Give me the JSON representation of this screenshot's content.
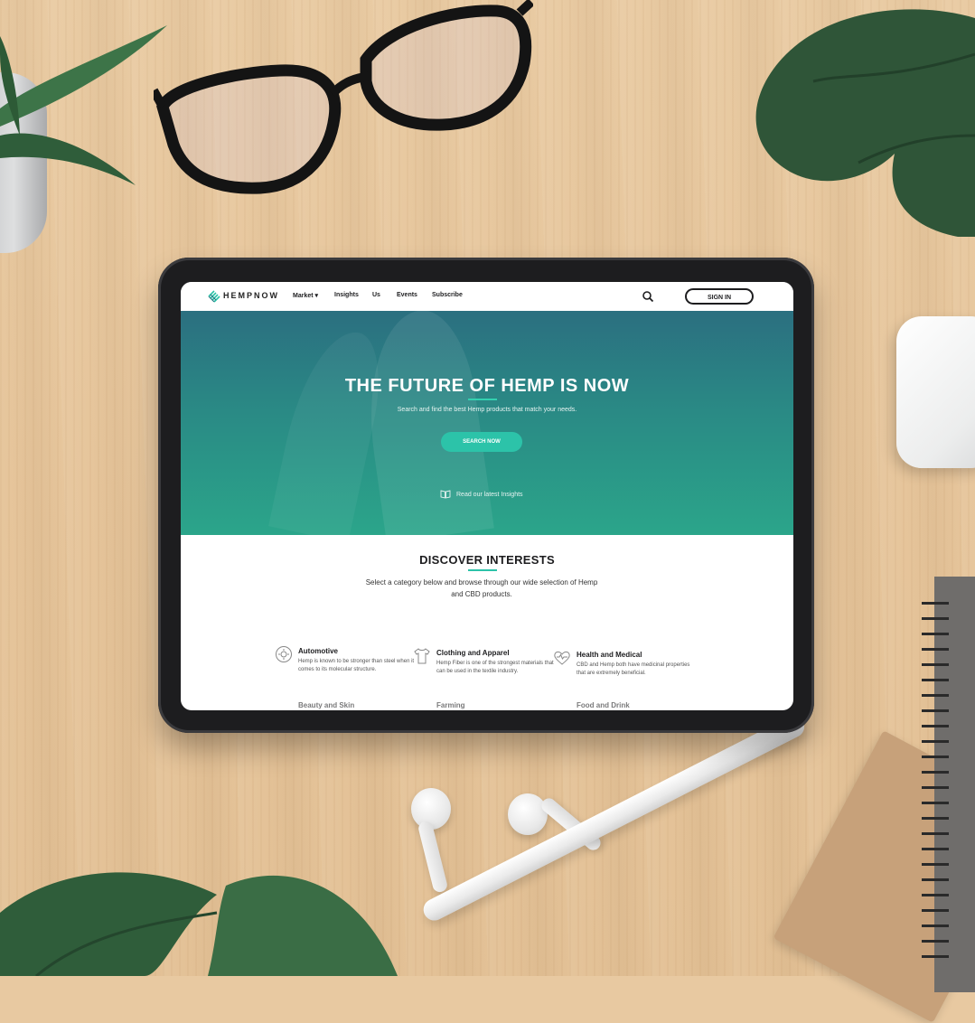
{
  "site": {
    "brand": "HEMPNOW",
    "brand_color": "#2cc3a9"
  },
  "nav": {
    "items": [
      "Market",
      "Insights",
      "Us",
      "Events",
      "Subscribe"
    ],
    "market_dropdown_icon": "chevron-down-icon",
    "search_icon": "search-icon",
    "signin_label": "SIGN IN"
  },
  "hero": {
    "title": "THE FUTURE OF HEMP IS NOW",
    "subtitle": "Search and find the best Hemp products that match your needs.",
    "cta_label": "SEARCH NOW",
    "insights_label": "Read our latest Insights",
    "insights_icon": "book-icon"
  },
  "discover": {
    "title": "DISCOVER INTERESTS",
    "subtitle": "Select a category below and browse through our wide selection of Hemp and CBD products.",
    "categories": [
      {
        "title": "Automotive",
        "desc": "Hemp is known to be stronger than steel when it comes to its molecular structure.",
        "icon": "gear-icon"
      },
      {
        "title": "Clothing and Apparel",
        "desc": "Hemp Fiber is one of the strongest materials that can be used in the textile industry.",
        "icon": "shirt-icon"
      },
      {
        "title": "Health and Medical",
        "desc": "CBD and Hemp both have medicinal properties that are extremely beneficial.",
        "icon": "heart-pulse-icon"
      }
    ],
    "partial_categories": [
      "Beauty and Skin",
      "Farming",
      "Food and Drink"
    ]
  }
}
